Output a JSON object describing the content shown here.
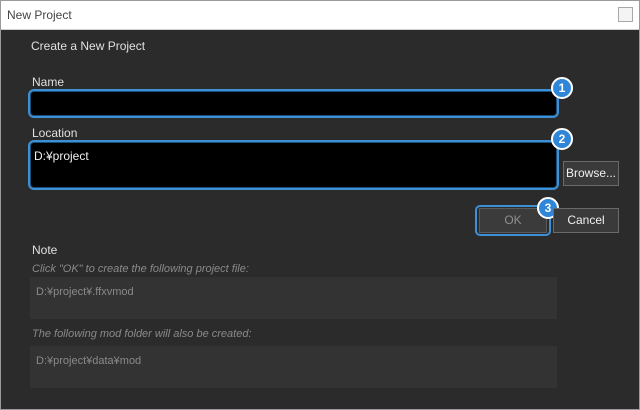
{
  "window": {
    "title": "New Project"
  },
  "dialog": {
    "heading": "Create a New Project",
    "name": {
      "label": "Name",
      "value": ""
    },
    "location": {
      "label": "Location",
      "value": "D:¥project"
    },
    "buttons": {
      "browse": "Browse...",
      "ok": "OK",
      "cancel": "Cancel"
    },
    "note": {
      "label": "Note",
      "project_file_hint": "Click \"OK\" to create the following project file:",
      "project_file_path": "D:¥project¥.ffxvmod",
      "mod_folder_hint": "The following mod folder will also be created:",
      "mod_folder_path": "D:¥project¥data¥mod"
    }
  },
  "callouts": [
    "1",
    "2",
    "3"
  ],
  "colors": {
    "accent": "#3d8fd6",
    "background": "#2b2b2b",
    "field_background": "#000000"
  }
}
